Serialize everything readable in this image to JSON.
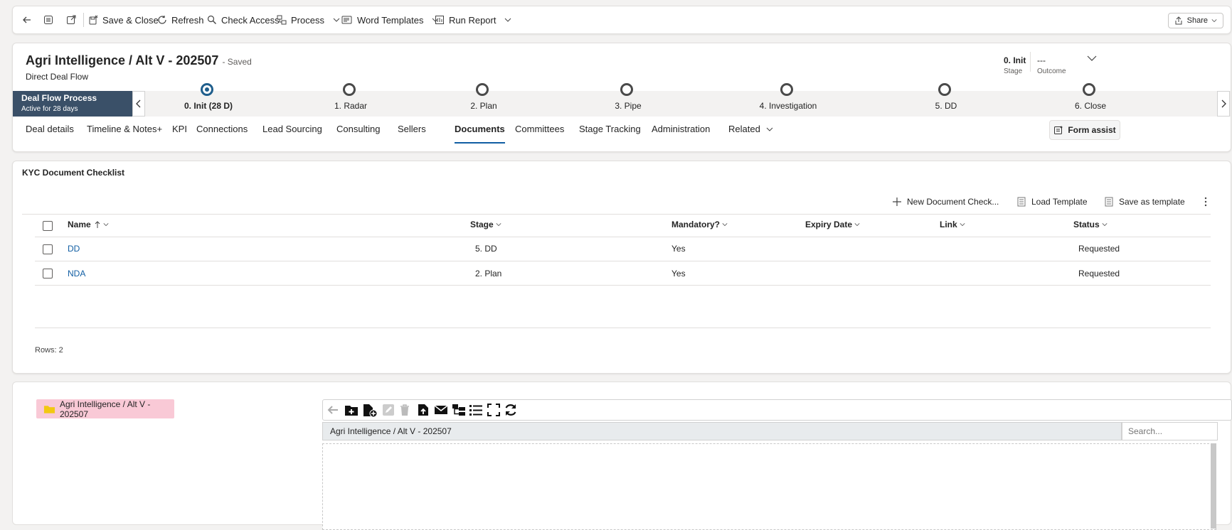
{
  "toolbar": {
    "back_icon": "back-arrow-icon",
    "save_close": "Save & Close",
    "refresh": "Refresh",
    "check_access": "Check Access",
    "process": "Process",
    "word_templates": "Word Templates",
    "run_report": "Run Report",
    "share": "Share"
  },
  "header": {
    "title": "Agri Intelligence / Alt V - 202507",
    "saved": "- Saved",
    "subtitle": "Direct Deal Flow",
    "stage_value": "0. Init",
    "stage_label": "Stage",
    "outcome_value": "---",
    "outcome_label": "Outcome"
  },
  "bpf": {
    "name": "Deal Flow Process",
    "active": "Active for 28 days",
    "stages": [
      "0. Init  (28 D)",
      "1. Radar",
      "2. Plan",
      "3. Pipe",
      "4. Investigation",
      "5. DD",
      "6. Close"
    ],
    "active_stage_index": 0
  },
  "tabs": [
    "Deal details",
    "Timeline & Notes+",
    "KPI",
    "Connections",
    "Lead Sourcing",
    "Consulting",
    "Sellers",
    "Documents",
    "Committees",
    "Stage Tracking",
    "Administration",
    "Related"
  ],
  "selected_tab": "Documents",
  "form_assist": "Form assist",
  "kyc": {
    "title": "KYC Document Checklist",
    "commands": {
      "new": "New Document Check...",
      "load": "Load Template",
      "save": "Save as template"
    },
    "columns": [
      "Name",
      "Stage",
      "Mandatory?",
      "Expiry Date",
      "Link",
      "Status"
    ],
    "rows": [
      {
        "name": "DD",
        "stage": "5. DD",
        "mandatory": "Yes",
        "expiry": "",
        "link": "",
        "status": "Requested"
      },
      {
        "name": "NDA",
        "stage": "2. Plan",
        "mandatory": "Yes",
        "expiry": "",
        "link": "",
        "status": "Requested"
      }
    ],
    "rows_label": "Rows: 2"
  },
  "explorer": {
    "folder": "Agri Intelligence / Alt V - 202507",
    "path": "Agri Intelligence / Alt V - 202507",
    "search_placeholder": "Search..."
  },
  "colors": {
    "bpf_name_bg": "#3a5068",
    "link": "#115ea3",
    "folder_bg": "#f9c9d6",
    "folder_icon": "#f2c811"
  }
}
